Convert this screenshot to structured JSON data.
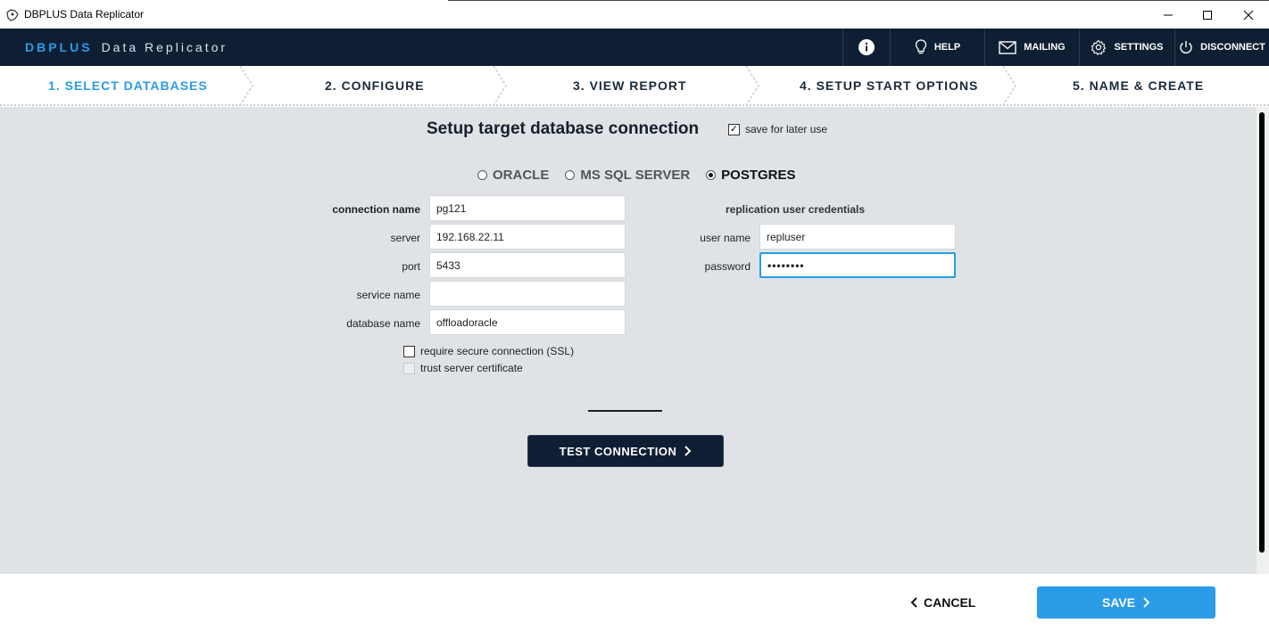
{
  "window": {
    "title": "DBPLUS Data Replicator"
  },
  "header": {
    "brand_primary": "DBPLUS",
    "brand_secondary": "Data Replicator",
    "help": "HELP",
    "mailing": "MAILING",
    "settings": "SETTINGS",
    "disconnect": "DISCONNECT"
  },
  "steps": [
    {
      "label": "1. SELECT DATABASES",
      "active": true
    },
    {
      "label": "2. CONFIGURE"
    },
    {
      "label": "3. VIEW REPORT"
    },
    {
      "label": "4. SETUP START OPTIONS"
    },
    {
      "label": "5. NAME & CREATE"
    }
  ],
  "form": {
    "heading": "Setup target database connection",
    "save_for_later": {
      "label": "save for later use",
      "checked": true
    },
    "db_types": [
      "ORACLE",
      "MS SQL SERVER",
      "POSTGRES"
    ],
    "selected_db_type": "POSTGRES",
    "connection_name": {
      "label": "connection name",
      "value": "pg121"
    },
    "server": {
      "label": "server",
      "value": "192.168.22.11"
    },
    "port": {
      "label": "port",
      "value": "5433"
    },
    "service_name": {
      "label": "service name",
      "value": ""
    },
    "database_name": {
      "label": "database name",
      "value": "offloadoracle"
    },
    "credentials_heading": "replication user credentials",
    "user_name": {
      "label": "user name",
      "value": "repluser"
    },
    "password": {
      "label": "password",
      "value": "••••••••"
    },
    "require_ssl": {
      "label": "require secure connection (SSL)",
      "checked": false
    },
    "trust_cert": {
      "label": "trust server certificate",
      "checked": false,
      "disabled": true
    },
    "test_button": "TEST CONNECTION"
  },
  "footer": {
    "cancel": "CANCEL",
    "save": "SAVE"
  },
  "colors": {
    "accent": "#2a9be6",
    "navy": "#0f1f33",
    "panel": "#e0e3e6"
  }
}
